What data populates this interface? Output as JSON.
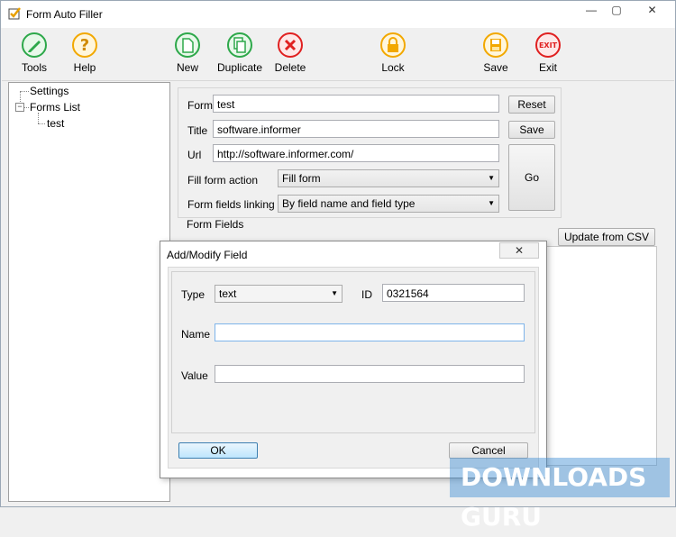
{
  "window": {
    "title": "Form Auto Filler",
    "minimize": "—",
    "maximize": "▢",
    "close": "✕"
  },
  "toolbar": [
    {
      "key": "tools",
      "label": "Tools",
      "icon": "pencil-icon",
      "color": "#2da84a"
    },
    {
      "key": "help",
      "label": "Help",
      "icon": "question-icon",
      "color": "#f2a800"
    },
    {
      "key": "new",
      "label": "New",
      "icon": "new-document-icon",
      "color": "#2da84a"
    },
    {
      "key": "duplicate",
      "label": "Duplicate",
      "icon": "duplicate-icon",
      "color": "#2da84a"
    },
    {
      "key": "delete",
      "label": "Delete",
      "icon": "delete-x-icon",
      "color": "#e02020"
    },
    {
      "key": "lock",
      "label": "Lock",
      "icon": "lock-icon",
      "color": "#f2a800"
    },
    {
      "key": "save",
      "label": "Save",
      "icon": "floppy-save-icon",
      "color": "#f2a800"
    },
    {
      "key": "exit",
      "label": "Exit",
      "icon": "exit-icon",
      "color": "#e02020",
      "icon_text": "EXIT"
    }
  ],
  "tree": {
    "settings": "Settings",
    "forms_list": "Forms List",
    "form_item": "test",
    "collapse_glyph": "−"
  },
  "form": {
    "form_label": "Form",
    "form_value": "test",
    "title_label": "Title",
    "title_value": "software.informer",
    "url_label": "Url",
    "url_value": "http://software.informer.com/",
    "fill_action_label": "Fill form action",
    "fill_action_value": "Fill form",
    "linking_label": "Form fields linking",
    "linking_value": "By field name and field type",
    "reset_button": "Reset",
    "save_button": "Save",
    "go_button": "Go",
    "form_fields_label": "Form Fields",
    "update_csv_button": "Update from CSV"
  },
  "dialog": {
    "title": "Add/Modify Field",
    "close": "✕",
    "type_label": "Type",
    "type_value": "text",
    "id_label": "ID",
    "id_value": "0321564",
    "name_label": "Name",
    "name_value": "",
    "value_label": "Value",
    "value_value": "",
    "ok_button": "OK",
    "cancel_button": "Cancel"
  },
  "watermark": {
    "text": "DOWNLOADS GURU",
    "dot_before_guru": "."
  }
}
